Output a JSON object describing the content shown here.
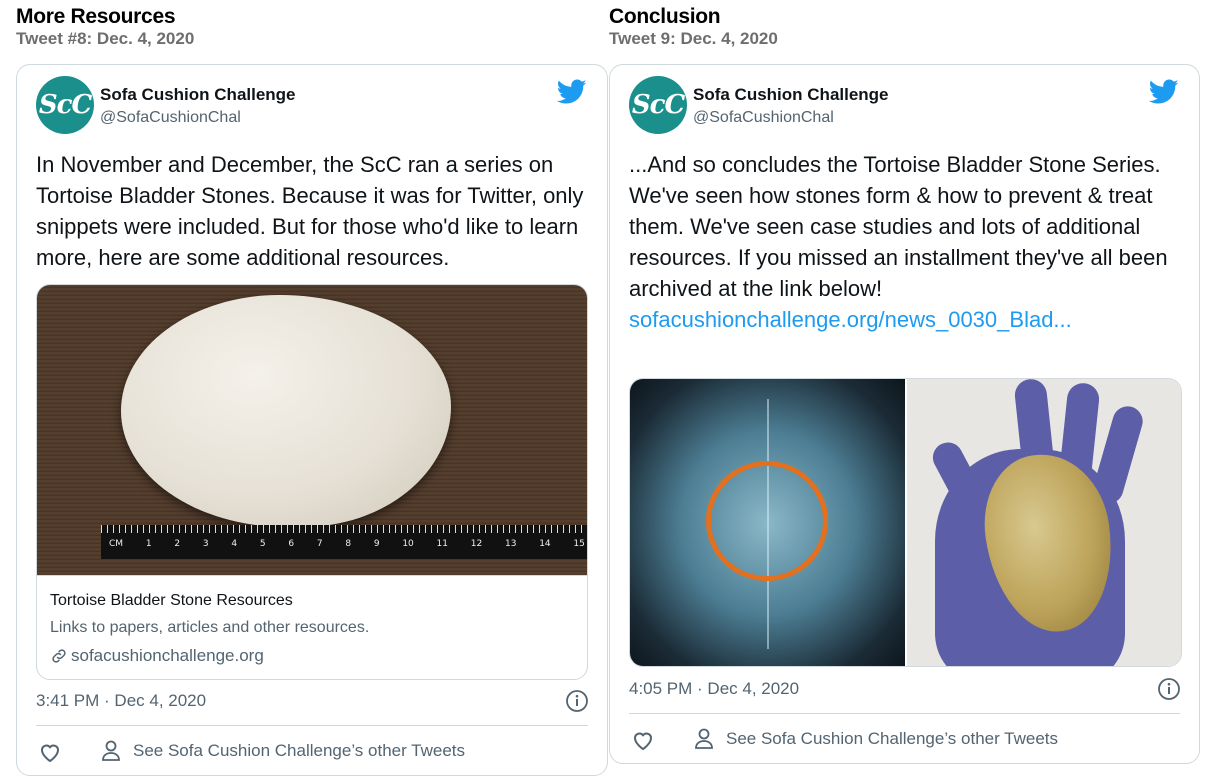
{
  "colors": {
    "twitter_blue": "#1d9bf0",
    "avatar_teal": "#1a8f8b",
    "border": "#cfd9de",
    "muted": "#536471"
  },
  "left": {
    "section_title": "More Resources",
    "section_sub": "Tweet #8: Dec. 4, 2020",
    "tweet": {
      "avatar_text": "ScC",
      "name": "Sofa Cushion Challenge",
      "handle": "@SofaCushionChal",
      "text": "In November and December, the ScC ran a series on Tortoise Bladder Stones. Because it was for Twitter, only snippets were included. But for those who'd like to learn more, here are some additional resources.",
      "link_card": {
        "title": "Tortoise Bladder Stone Resources",
        "description": "Links to papers, articles and other resources.",
        "domain": "sofacushionchallenge.org",
        "ruler_label": "CM",
        "ruler_numbers": [
          "1",
          "2",
          "3",
          "4",
          "5",
          "6",
          "7",
          "8",
          "9",
          "10",
          "11",
          "12",
          "13",
          "14",
          "15"
        ]
      },
      "timestamp": "3:41 PM · Dec 4, 2020",
      "other_tweets": "See Sofa Cushion Challenge’s other Tweets"
    }
  },
  "right": {
    "section_title": "Conclusion",
    "section_sub": "Tweet 9: Dec. 4, 2020",
    "tweet": {
      "avatar_text": "ScC",
      "name": "Sofa Cushion Challenge",
      "handle": "@SofaCushionChal",
      "text": "...And so concludes the Tortoise Bladder Stone Series.  We've seen how stones form & how to prevent & treat them.  We've seen case studies and lots of additional resources.  If you missed an installment they've all been archived at the link below!",
      "link": "sofacushionchallenge.org/news_0030_Blad...",
      "timestamp": "4:05 PM · Dec 4, 2020",
      "other_tweets": "See Sofa Cushion Challenge’s other Tweets"
    }
  }
}
